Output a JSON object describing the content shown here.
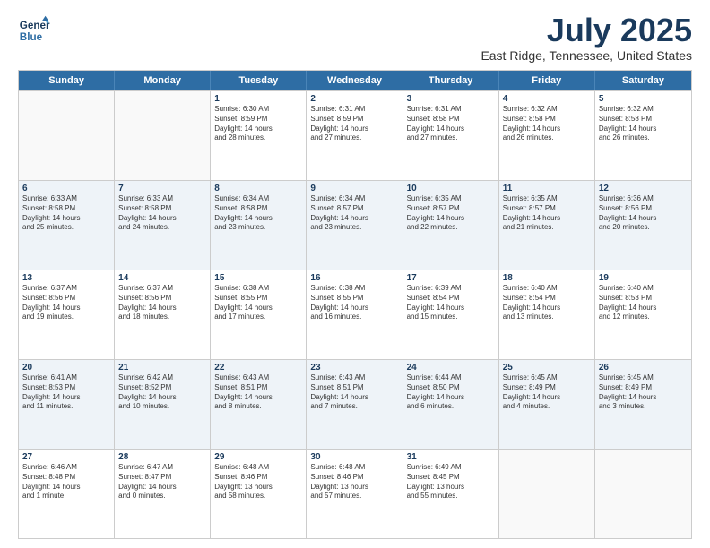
{
  "header": {
    "logo_line1": "General",
    "logo_line2": "Blue",
    "month": "July 2025",
    "location": "East Ridge, Tennessee, United States"
  },
  "weekdays": [
    "Sunday",
    "Monday",
    "Tuesday",
    "Wednesday",
    "Thursday",
    "Friday",
    "Saturday"
  ],
  "rows": [
    {
      "alt": false,
      "cells": [
        {
          "day": "",
          "text": ""
        },
        {
          "day": "",
          "text": ""
        },
        {
          "day": "1",
          "text": "Sunrise: 6:30 AM\nSunset: 8:59 PM\nDaylight: 14 hours\nand 28 minutes."
        },
        {
          "day": "2",
          "text": "Sunrise: 6:31 AM\nSunset: 8:59 PM\nDaylight: 14 hours\nand 27 minutes."
        },
        {
          "day": "3",
          "text": "Sunrise: 6:31 AM\nSunset: 8:58 PM\nDaylight: 14 hours\nand 27 minutes."
        },
        {
          "day": "4",
          "text": "Sunrise: 6:32 AM\nSunset: 8:58 PM\nDaylight: 14 hours\nand 26 minutes."
        },
        {
          "day": "5",
          "text": "Sunrise: 6:32 AM\nSunset: 8:58 PM\nDaylight: 14 hours\nand 26 minutes."
        }
      ]
    },
    {
      "alt": true,
      "cells": [
        {
          "day": "6",
          "text": "Sunrise: 6:33 AM\nSunset: 8:58 PM\nDaylight: 14 hours\nand 25 minutes."
        },
        {
          "day": "7",
          "text": "Sunrise: 6:33 AM\nSunset: 8:58 PM\nDaylight: 14 hours\nand 24 minutes."
        },
        {
          "day": "8",
          "text": "Sunrise: 6:34 AM\nSunset: 8:58 PM\nDaylight: 14 hours\nand 23 minutes."
        },
        {
          "day": "9",
          "text": "Sunrise: 6:34 AM\nSunset: 8:57 PM\nDaylight: 14 hours\nand 23 minutes."
        },
        {
          "day": "10",
          "text": "Sunrise: 6:35 AM\nSunset: 8:57 PM\nDaylight: 14 hours\nand 22 minutes."
        },
        {
          "day": "11",
          "text": "Sunrise: 6:35 AM\nSunset: 8:57 PM\nDaylight: 14 hours\nand 21 minutes."
        },
        {
          "day": "12",
          "text": "Sunrise: 6:36 AM\nSunset: 8:56 PM\nDaylight: 14 hours\nand 20 minutes."
        }
      ]
    },
    {
      "alt": false,
      "cells": [
        {
          "day": "13",
          "text": "Sunrise: 6:37 AM\nSunset: 8:56 PM\nDaylight: 14 hours\nand 19 minutes."
        },
        {
          "day": "14",
          "text": "Sunrise: 6:37 AM\nSunset: 8:56 PM\nDaylight: 14 hours\nand 18 minutes."
        },
        {
          "day": "15",
          "text": "Sunrise: 6:38 AM\nSunset: 8:55 PM\nDaylight: 14 hours\nand 17 minutes."
        },
        {
          "day": "16",
          "text": "Sunrise: 6:38 AM\nSunset: 8:55 PM\nDaylight: 14 hours\nand 16 minutes."
        },
        {
          "day": "17",
          "text": "Sunrise: 6:39 AM\nSunset: 8:54 PM\nDaylight: 14 hours\nand 15 minutes."
        },
        {
          "day": "18",
          "text": "Sunrise: 6:40 AM\nSunset: 8:54 PM\nDaylight: 14 hours\nand 13 minutes."
        },
        {
          "day": "19",
          "text": "Sunrise: 6:40 AM\nSunset: 8:53 PM\nDaylight: 14 hours\nand 12 minutes."
        }
      ]
    },
    {
      "alt": true,
      "cells": [
        {
          "day": "20",
          "text": "Sunrise: 6:41 AM\nSunset: 8:53 PM\nDaylight: 14 hours\nand 11 minutes."
        },
        {
          "day": "21",
          "text": "Sunrise: 6:42 AM\nSunset: 8:52 PM\nDaylight: 14 hours\nand 10 minutes."
        },
        {
          "day": "22",
          "text": "Sunrise: 6:43 AM\nSunset: 8:51 PM\nDaylight: 14 hours\nand 8 minutes."
        },
        {
          "day": "23",
          "text": "Sunrise: 6:43 AM\nSunset: 8:51 PM\nDaylight: 14 hours\nand 7 minutes."
        },
        {
          "day": "24",
          "text": "Sunrise: 6:44 AM\nSunset: 8:50 PM\nDaylight: 14 hours\nand 6 minutes."
        },
        {
          "day": "25",
          "text": "Sunrise: 6:45 AM\nSunset: 8:49 PM\nDaylight: 14 hours\nand 4 minutes."
        },
        {
          "day": "26",
          "text": "Sunrise: 6:45 AM\nSunset: 8:49 PM\nDaylight: 14 hours\nand 3 minutes."
        }
      ]
    },
    {
      "alt": false,
      "cells": [
        {
          "day": "27",
          "text": "Sunrise: 6:46 AM\nSunset: 8:48 PM\nDaylight: 14 hours\nand 1 minute."
        },
        {
          "day": "28",
          "text": "Sunrise: 6:47 AM\nSunset: 8:47 PM\nDaylight: 14 hours\nand 0 minutes."
        },
        {
          "day": "29",
          "text": "Sunrise: 6:48 AM\nSunset: 8:46 PM\nDaylight: 13 hours\nand 58 minutes."
        },
        {
          "day": "30",
          "text": "Sunrise: 6:48 AM\nSunset: 8:46 PM\nDaylight: 13 hours\nand 57 minutes."
        },
        {
          "day": "31",
          "text": "Sunrise: 6:49 AM\nSunset: 8:45 PM\nDaylight: 13 hours\nand 55 minutes."
        },
        {
          "day": "",
          "text": ""
        },
        {
          "day": "",
          "text": ""
        }
      ]
    }
  ]
}
